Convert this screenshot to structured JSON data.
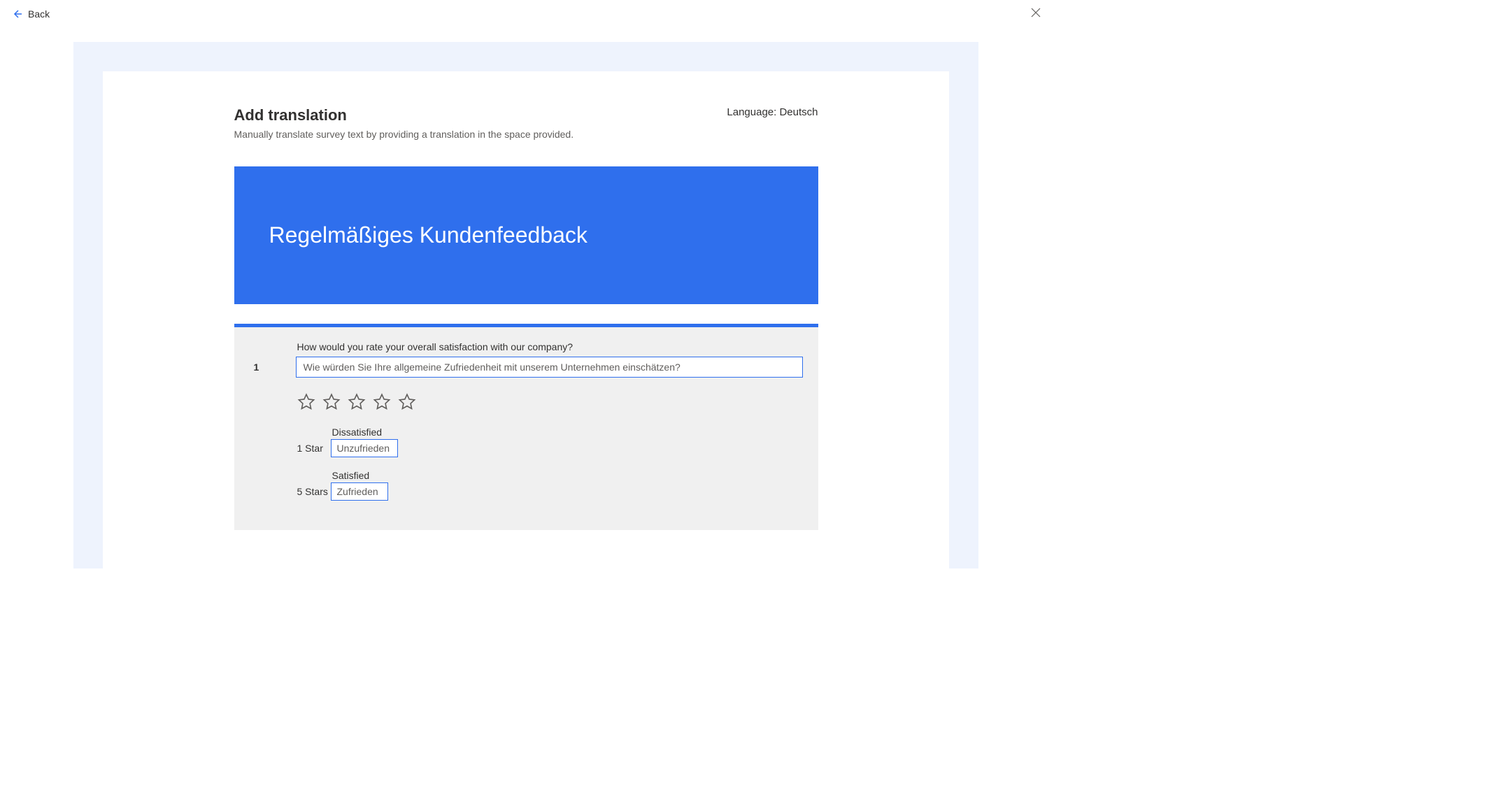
{
  "topbar": {
    "back_label": "Back"
  },
  "header": {
    "title": "Add translation",
    "subtitle": "Manually translate survey text by providing a translation in the space provided.",
    "language_label": "Language: Deutsch"
  },
  "banner": {
    "title": "Regelmäßiges Kundenfeedback"
  },
  "question": {
    "number": "1",
    "source_text": "How would you rate your overall satisfaction with our company?",
    "translation": "Wie würden Sie Ihre allgemeine Zufriedenheit mit unserem Unternehmen einschätzen?"
  },
  "rating_labels": {
    "low": {
      "key": "1 Star",
      "source": "Dissatisfied",
      "translation": "Unzufrieden"
    },
    "high": {
      "key": "5 Stars",
      "source": "Satisfied",
      "translation": "Zufrieden"
    }
  }
}
